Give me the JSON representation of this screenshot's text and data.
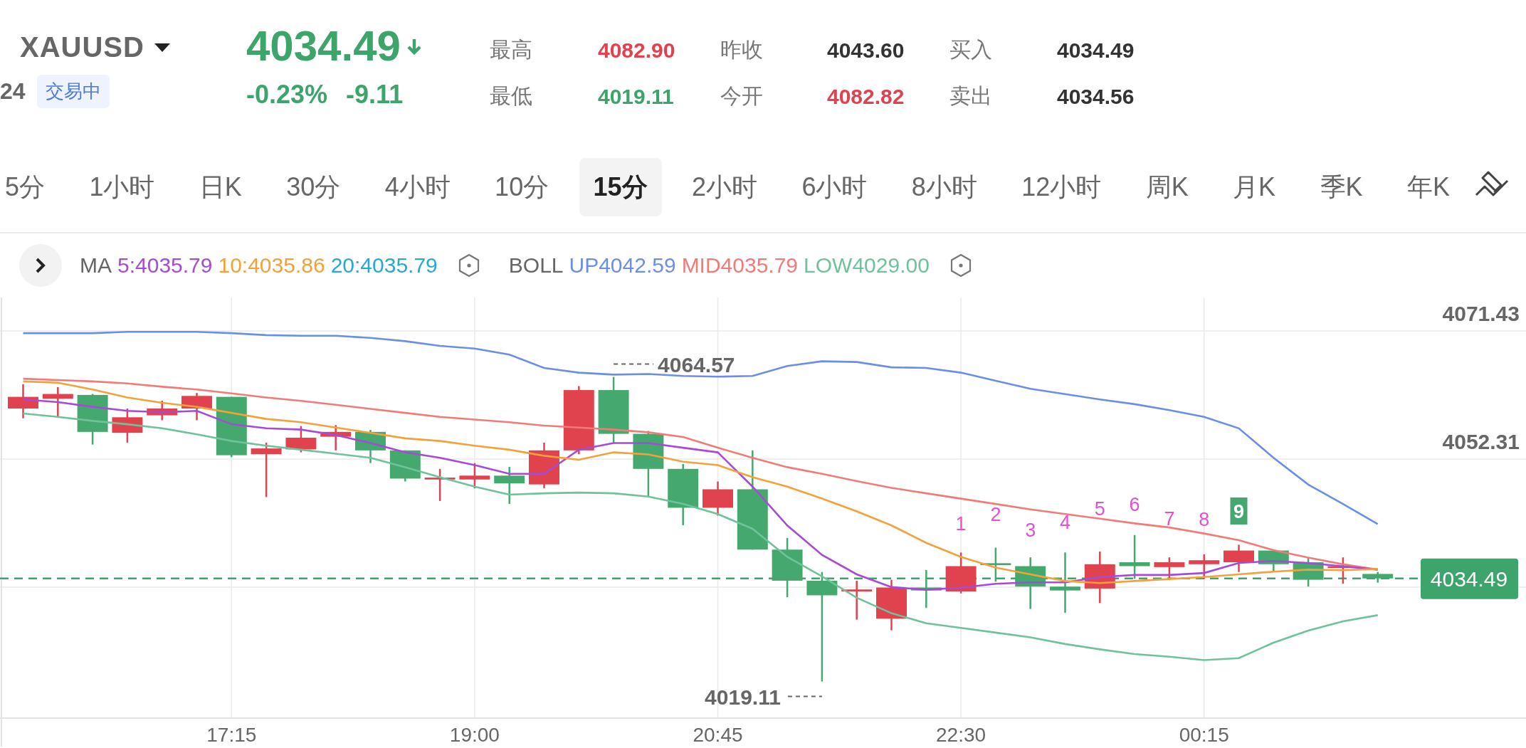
{
  "header": {
    "symbol": "XAUUSD",
    "code_tail": "24",
    "status_badge": "交易中",
    "price": "4034.49",
    "color": "#3da46c",
    "change_percent": "-0.23%",
    "change": "-9.11"
  },
  "stats": [
    {
      "label": "最高",
      "value": "4082.90",
      "color": "#e0424e"
    },
    {
      "label": "昨收",
      "value": "4043.60",
      "color": "#333333"
    },
    {
      "label": "买入",
      "value": "4034.49",
      "color": "#333333"
    },
    {
      "label": "最低",
      "value": "4019.11",
      "color": "#3da46c"
    },
    {
      "label": "今开",
      "value": "4082.82",
      "color": "#e0424e"
    },
    {
      "label": "卖出",
      "value": "4034.56",
      "color": "#333333"
    }
  ],
  "timeframe_tabs": [
    {
      "label": "5分",
      "selected": false
    },
    {
      "label": "1小时",
      "selected": false
    },
    {
      "label": "日K",
      "selected": false
    },
    {
      "label": "30分",
      "selected": false
    },
    {
      "label": "4小时",
      "selected": false
    },
    {
      "label": "10分",
      "selected": false
    },
    {
      "label": "15分",
      "selected": true
    },
    {
      "label": "2小时",
      "selected": false
    },
    {
      "label": "6小时",
      "selected": false
    },
    {
      "label": "8小时",
      "selected": false
    },
    {
      "label": "12小时",
      "selected": false
    },
    {
      "label": "周K",
      "selected": false
    },
    {
      "label": "月K",
      "selected": false
    },
    {
      "label": "季K",
      "selected": false
    },
    {
      "label": "年K",
      "selected": false
    }
  ],
  "chart": {
    "legend": [
      {
        "name": "MA",
        "items": [
          {
            "text": "5:4035.79",
            "color": "#a64bd6"
          },
          {
            "text": "10:4035.86",
            "color": "#f5a13a"
          },
          {
            "text": "20:4035.79",
            "color": "#2aa7d4"
          }
        ]
      },
      {
        "name": "BOLL",
        "items": [
          {
            "text": "UP4042.59",
            "color": "#6b8ee6"
          },
          {
            "text": "MID4035.79",
            "color": "#f07b78"
          },
          {
            "text": "LOW4029.00",
            "color": "#6fc29a"
          }
        ]
      }
    ],
    "td_marks": [
      {
        "text": "1",
        "highlighted": false
      },
      {
        "text": "2",
        "highlighted": false
      },
      {
        "text": "3",
        "highlighted": false
      },
      {
        "text": "4",
        "highlighted": false
      },
      {
        "text": "5",
        "highlighted": false
      },
      {
        "text": "6",
        "highlighted": false
      },
      {
        "text": "7",
        "highlighted": false
      },
      {
        "text": "8",
        "highlighted": false
      },
      {
        "text": "9",
        "highlighted": true
      }
    ],
    "chart_data": {
      "type": "candlestick",
      "categories": [
        null,
        null,
        null,
        null,
        null,
        null,
        "17:15",
        null,
        null,
        null,
        null,
        null,
        null,
        "19:00",
        null,
        null,
        null,
        null,
        null,
        null,
        "20:45",
        null,
        null,
        null,
        null,
        null,
        null,
        "22:30",
        null,
        null,
        null,
        null,
        null,
        null,
        "00:15",
        null,
        null,
        null,
        null,
        null
      ],
      "ylim": [
        4013.64,
        4076.42
      ],
      "yticks": [
        4071.43,
        4052.31
      ],
      "grid": true,
      "ref_lines": [
        {
          "axis": "y",
          "value": 4034.49,
          "label": "4034.49",
          "color": "#3da46c"
        }
      ],
      "series": [
        {
          "type": "line",
          "color": "#6b8ee6",
          "values": [
            4071.1,
            4071.1,
            4071.1,
            4071.3,
            4071.3,
            4071.3,
            4071.1,
            4070.8,
            4070.7,
            4070.7,
            4070.4,
            4069.9,
            4069.2,
            4068.8,
            4067.9,
            4065.9,
            4065.2,
            4064.9,
            4065.0,
            4064.7,
            4064.6,
            4064.7,
            4066.2,
            4066.9,
            4066.8,
            4066.0,
            4065.9,
            4065.2,
            4064.0,
            4062.8,
            4062.0,
            4061.2,
            4060.5,
            4059.6,
            4058.6,
            4056.9,
            4052.5,
            4048.5,
            4045.6,
            4042.6
          ]
        },
        {
          "type": "line",
          "color": "#f07b78",
          "values": [
            4064.3,
            4064.1,
            4063.9,
            4063.6,
            4063.1,
            4062.7,
            4062.1,
            4061.5,
            4061.0,
            4060.4,
            4059.8,
            4059.2,
            4058.6,
            4058.2,
            4057.8,
            4057.3,
            4057.0,
            4056.7,
            4056.3,
            4055.6,
            4054.0,
            4052.5,
            4051.1,
            4050.1,
            4049.0,
            4048.0,
            4047.2,
            4046.4,
            4045.6,
            4044.8,
            4044.1,
            4043.4,
            4042.7,
            4042.1,
            4041.2,
            4040.2,
            4038.7,
            4037.6,
            4036.6,
            4035.8
          ]
        },
        {
          "type": "line",
          "color": "#6fc29a",
          "values": [
            4059.1,
            4058.6,
            4058.0,
            4057.5,
            4056.9,
            4056.0,
            4055.0,
            4054.3,
            4053.7,
            4053.1,
            4052.5,
            4051.1,
            4049.6,
            4048.2,
            4047.0,
            4047.2,
            4047.3,
            4047.2,
            4046.7,
            4045.6,
            4044.1,
            4041.9,
            4037.7,
            4034.8,
            4031.6,
            4029.3,
            4027.8,
            4027.1,
            4026.4,
            4025.7,
            4024.7,
            4023.9,
            4023.2,
            4022.8,
            4022.3,
            4022.6,
            4024.9,
            4026.7,
            4028.1,
            4029.0
          ]
        },
        {
          "type": "line",
          "color": "#a64bd6",
          "values": [
            4061.2,
            4060.8,
            4060.1,
            4059.5,
            4059.3,
            4059.5,
            4057.5,
            4056.9,
            4056.7,
            4055.9,
            4054.7,
            4053.3,
            4052.5,
            4051.4,
            4050.1,
            4050.1,
            4053.7,
            4054.7,
            4054.7,
            4054.0,
            4053.3,
            4048.2,
            4042.4,
            4038.0,
            4035.1,
            4033.2,
            4032.8,
            4033.1,
            4033.7,
            4033.9,
            4033.9,
            4034.7,
            4035.0,
            4035.0,
            4035.3,
            4036.8,
            4037.1,
            4036.8,
            4036.3,
            4035.8
          ]
        },
        {
          "type": "line",
          "color": "#f5a13a",
          "values": [
            4063.9,
            4063.7,
            4062.7,
            4061.5,
            4060.7,
            4060.1,
            4059.2,
            4058.3,
            4057.8,
            4057.0,
            4056.2,
            4055.4,
            4055.0,
            4054.3,
            4053.7,
            4052.8,
            4052.2,
            4053.3,
            4053.0,
            4051.9,
            4051.4,
            4049.6,
            4048.2,
            4046.4,
            4044.5,
            4042.4,
            4039.8,
            4037.7,
            4036.1,
            4035.1,
            4034.1,
            4033.8,
            4034.1,
            4034.4,
            4034.7,
            4035.1,
            4035.5,
            4035.8,
            4035.7,
            4035.9
          ]
        }
      ],
      "ohlc": [
        [
          4059.85,
          4063.48,
          4058.39,
          4061.59
        ],
        [
          4061.3,
          4063.04,
          4058.68,
          4062.02
        ],
        [
          4061.88,
          4062.02,
          4054.47,
          4056.36
        ],
        [
          4056.22,
          4059.85,
          4054.76,
          4058.54
        ],
        [
          4058.83,
          4061.01,
          4058.1,
          4059.85
        ],
        [
          4059.85,
          4062.17,
          4058.1,
          4061.73
        ],
        [
          4061.59,
          4061.59,
          4052.59,
          4052.88
        ],
        [
          4053.02,
          4054.76,
          4046.63,
          4053.89
        ],
        [
          4053.75,
          4057.23,
          4053.31,
          4055.49
        ],
        [
          4055.64,
          4057.38,
          4053.6,
          4056.36
        ],
        [
          4056.36,
          4056.65,
          4051.71,
          4053.6
        ],
        [
          4053.6,
          4053.6,
          4048.96,
          4049.39
        ],
        [
          4049.25,
          4050.84,
          4046.05,
          4049.54
        ],
        [
          4049.25,
          4051.71,
          4047.94,
          4049.83
        ],
        [
          4049.83,
          4051.13,
          4045.62,
          4048.67
        ],
        [
          4048.52,
          4054.76,
          4047.94,
          4053.6
        ],
        [
          4053.6,
          4063.19,
          4053.02,
          4062.6
        ],
        [
          4062.6,
          4064.57,
          4054.76,
          4056.07
        ],
        [
          4056.07,
          4056.51,
          4046.78,
          4050.84
        ],
        [
          4050.84,
          4051.57,
          4042.42,
          4045.04
        ],
        [
          4045.04,
          4048.96,
          4043.87,
          4047.79
        ],
        [
          4047.79,
          4053.6,
          4038.79,
          4038.79
        ],
        [
          4038.79,
          4040.53,
          4031.68,
          4034.15
        ],
        [
          4034.15,
          4035.45,
          4019.11,
          4031.97
        ],
        [
          4032.55,
          4034.15,
          4028.34,
          4032.84
        ],
        [
          4028.48,
          4034.29,
          4026.74,
          4033.13
        ],
        [
          4033.13,
          4035.74,
          4030.08,
          4032.69
        ],
        [
          4032.55,
          4038.36,
          4032.26,
          4036.32
        ],
        [
          4036.76,
          4039.08,
          4034.0,
          4036.47
        ],
        [
          4036.32,
          4037.63,
          4029.93,
          4033.27
        ],
        [
          4033.27,
          4038.36,
          4029.35,
          4032.69
        ],
        [
          4032.98,
          4038.5,
          4030.81,
          4036.61
        ],
        [
          4036.9,
          4040.97,
          4034.44,
          4036.32
        ],
        [
          4036.18,
          4037.63,
          4034.44,
          4036.9
        ],
        [
          4036.61,
          4038.07,
          4034.44,
          4037.2
        ],
        [
          4036.9,
          4039.52,
          4035.45,
          4038.65
        ],
        [
          4038.65,
          4038.79,
          4035.45,
          4036.61
        ],
        [
          4036.9,
          4037.63,
          4033.27,
          4034.29
        ],
        [
          4036.03,
          4037.63,
          4033.71,
          4036.32
        ],
        [
          4035.16,
          4035.45,
          4033.86,
          4034.49
        ]
      ],
      "annotations": [
        "4064.57",
        "4019.11"
      ]
    }
  }
}
